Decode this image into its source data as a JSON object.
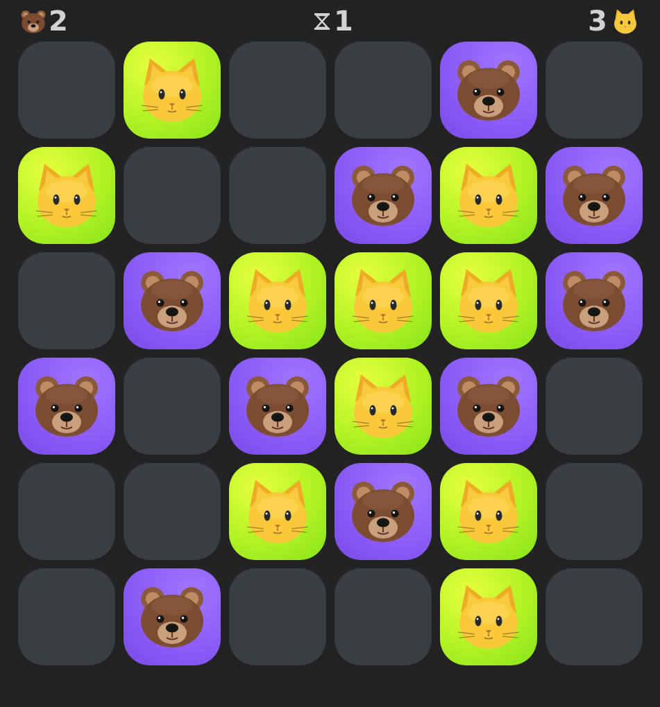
{
  "hud": {
    "bear_score": "2",
    "turn": "1",
    "cat_score": "3",
    "bear_icon": "bear-face-icon",
    "cat_icon": "cat-face-icon",
    "turn_icon": "hourglass-icon"
  },
  "board": {
    "rows": 6,
    "cols": 6,
    "cells": [
      [
        "empty",
        "cat",
        "empty",
        "empty",
        "bear",
        "empty"
      ],
      [
        "cat",
        "empty",
        "empty",
        "bear",
        "cat",
        "bear"
      ],
      [
        "empty",
        "bear",
        "cat",
        "cat",
        "cat",
        "bear"
      ],
      [
        "bear",
        "empty",
        "bear",
        "cat",
        "bear",
        "empty"
      ],
      [
        "empty",
        "empty",
        "cat",
        "bear",
        "cat",
        "empty"
      ],
      [
        "empty",
        "bear",
        "empty",
        "empty",
        "cat",
        "empty"
      ]
    ]
  },
  "colors": {
    "background": "#222222",
    "empty_cell": "#3a3d41",
    "bear_cell": "#8c5cf7",
    "cat_cell": "#b7f426",
    "hud_text": "#d2d2d2"
  }
}
